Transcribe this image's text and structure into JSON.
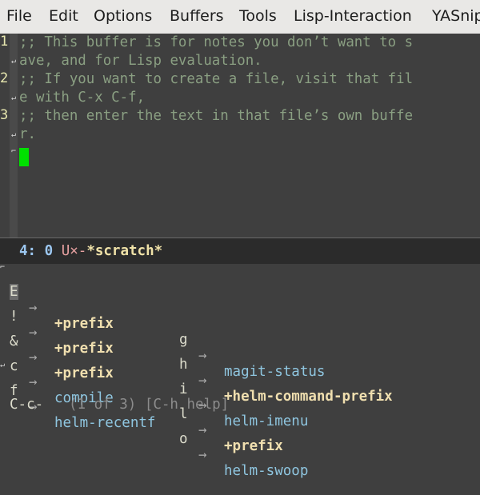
{
  "menubar": {
    "items": [
      "File",
      "Edit",
      "Options",
      "Buffers",
      "Tools",
      "Lisp-Interaction",
      "YASnip"
    ]
  },
  "editor": {
    "line_numbers": [
      "1",
      "2",
      "3"
    ],
    "visual_lines": [
      ";; This buffer is for notes you don’t want to s",
      "ave, and for Lisp evaluation.",
      ";; If you want to create a file, visit that fil",
      "e with C-x C-f,",
      ";; then enter the text in that file’s own buffe",
      "r."
    ]
  },
  "modeline": {
    "position": "4: 0",
    "flags": "U×-",
    "buffer_name": "*scratch*"
  },
  "which_key": {
    "arrow": "→",
    "left_column": [
      {
        "key": "E",
        "command": "+prefix",
        "is_prefix": true
      },
      {
        "key": "!",
        "command": "+prefix",
        "is_prefix": true
      },
      {
        "key": "&",
        "command": "+prefix",
        "is_prefix": true
      },
      {
        "key": "c",
        "command": "compile",
        "is_prefix": false
      },
      {
        "key": "f",
        "command": "helm-recentf",
        "is_prefix": false
      }
    ],
    "right_column": [
      {
        "key": "g",
        "command": "magit-status",
        "is_prefix": false
      },
      {
        "key": "h",
        "command": "+helm-command-prefix",
        "is_prefix": true
      },
      {
        "key": "i",
        "command": "helm-imenu",
        "is_prefix": false
      },
      {
        "key": "l",
        "command": "+prefix",
        "is_prefix": true
      },
      {
        "key": "o",
        "command": "helm-swoop",
        "is_prefix": false
      }
    ]
  },
  "echo": {
    "prefix": "C-c-",
    "page_info": "(1 of 3) [C-h help]"
  },
  "colors": {
    "background": "#3f3f3f",
    "comment": "#8a9f82",
    "cursor": "#00e000",
    "command": "#8fc6e0",
    "prefix": "#f0dfaf"
  }
}
